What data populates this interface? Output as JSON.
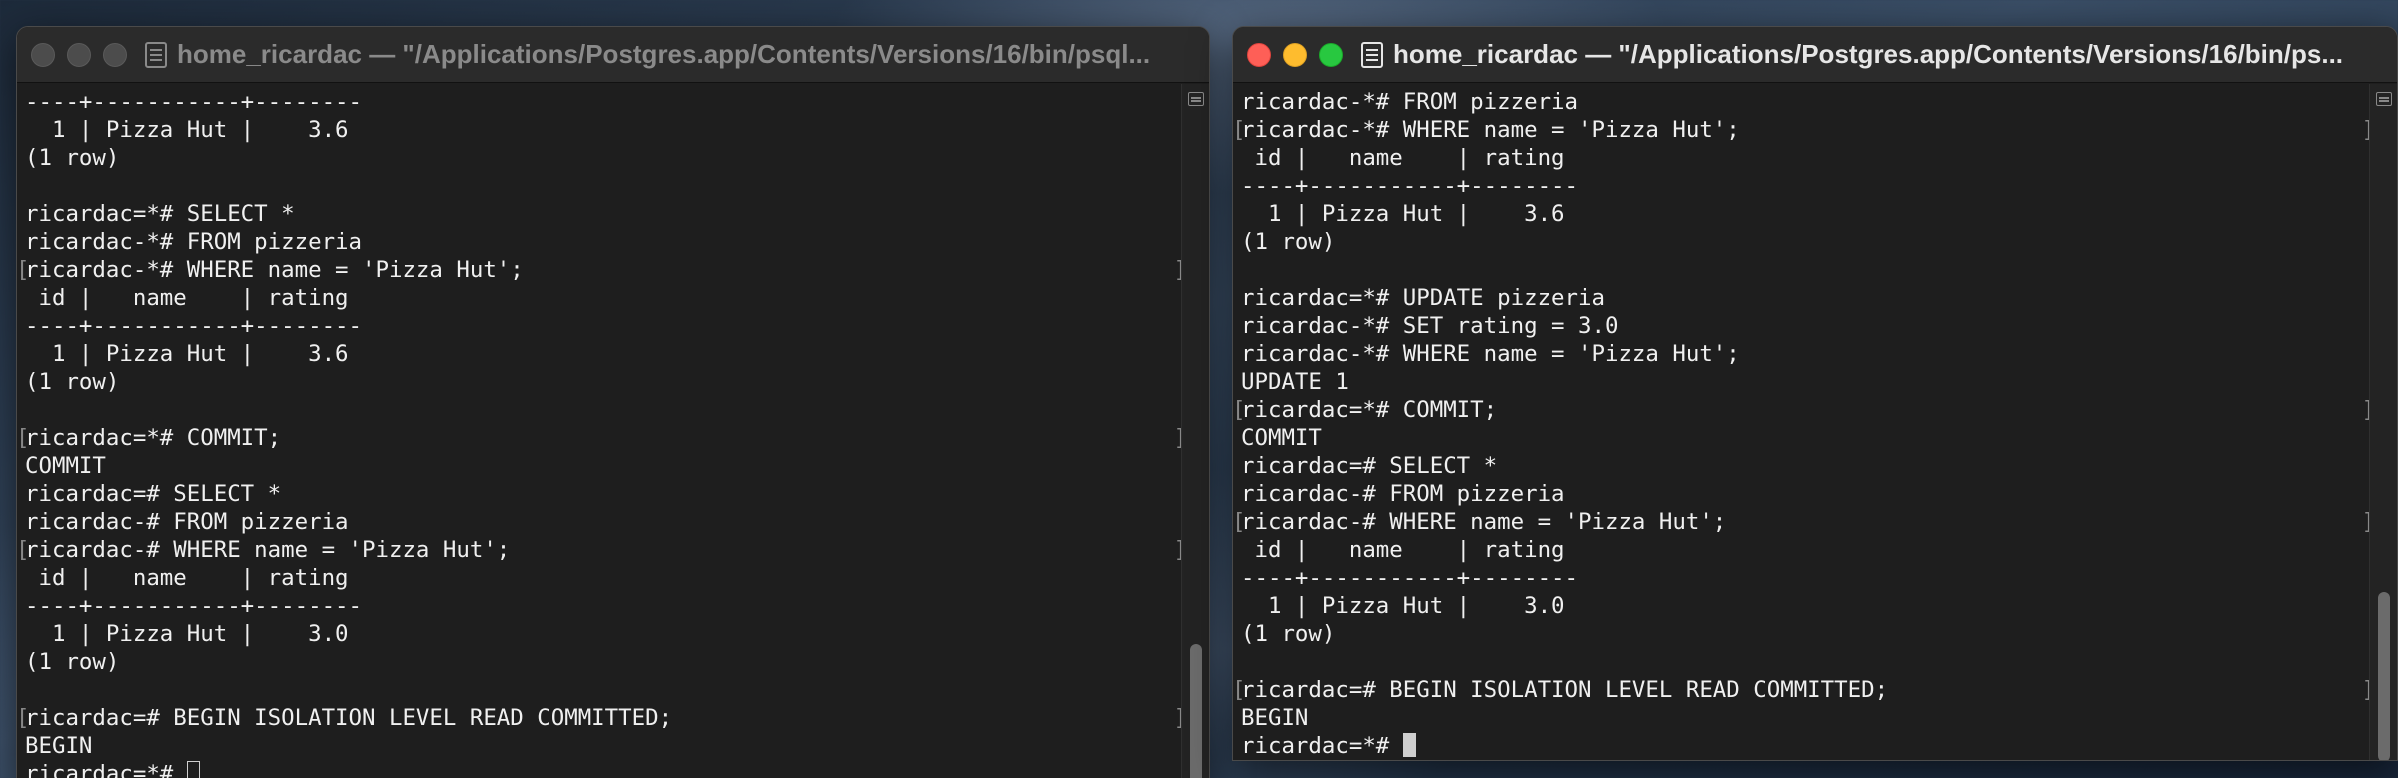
{
  "windows": {
    "left": {
      "title": "home_ricardac — \"/Applications/Postgres.app/Contents/Versions/16/bin/psql...",
      "lines": [
        {
          "text": "----+-----------+--------",
          "mark": false
        },
        {
          "text": "  1 | Pizza Hut |    3.6",
          "mark": false
        },
        {
          "text": "(1 row)",
          "mark": false
        },
        {
          "text": "",
          "mark": false
        },
        {
          "text": "ricardac=*# SELECT *",
          "mark": false
        },
        {
          "text": "ricardac-*# FROM pizzeria",
          "mark": false
        },
        {
          "text": "ricardac-*# WHERE name = 'Pizza Hut';",
          "mark": true
        },
        {
          "text": " id |   name    | rating",
          "mark": false
        },
        {
          "text": "----+-----------+--------",
          "mark": false
        },
        {
          "text": "  1 | Pizza Hut |    3.6",
          "mark": false
        },
        {
          "text": "(1 row)",
          "mark": false
        },
        {
          "text": "",
          "mark": false
        },
        {
          "text": "ricardac=*# COMMIT;",
          "mark": true
        },
        {
          "text": "COMMIT",
          "mark": false
        },
        {
          "text": "ricardac=# SELECT *",
          "mark": false
        },
        {
          "text": "ricardac-# FROM pizzeria",
          "mark": false
        },
        {
          "text": "ricardac-# WHERE name = 'Pizza Hut';",
          "mark": true
        },
        {
          "text": " id |   name    | rating",
          "mark": false
        },
        {
          "text": "----+-----------+--------",
          "mark": false
        },
        {
          "text": "  1 | Pizza Hut |    3.0",
          "mark": false
        },
        {
          "text": "(1 row)",
          "mark": false
        },
        {
          "text": "",
          "mark": false
        },
        {
          "text": "ricardac=# BEGIN ISOLATION LEVEL READ COMMITTED;",
          "mark": true
        },
        {
          "text": "BEGIN",
          "mark": false
        },
        {
          "text": "ricardac=*# ",
          "mark": false,
          "cursor": true
        }
      ]
    },
    "right": {
      "title": "home_ricardac — \"/Applications/Postgres.app/Contents/Versions/16/bin/ps...",
      "lines": [
        {
          "text": "ricardac-*# FROM pizzeria",
          "mark": false
        },
        {
          "text": "ricardac-*# WHERE name = 'Pizza Hut';",
          "mark": true
        },
        {
          "text": " id |   name    | rating",
          "mark": false
        },
        {
          "text": "----+-----------+--------",
          "mark": false
        },
        {
          "text": "  1 | Pizza Hut |    3.6",
          "mark": false
        },
        {
          "text": "(1 row)",
          "mark": false
        },
        {
          "text": "",
          "mark": false
        },
        {
          "text": "ricardac=*# UPDATE pizzeria",
          "mark": false
        },
        {
          "text": "ricardac-*# SET rating = 3.0",
          "mark": false
        },
        {
          "text": "ricardac-*# WHERE name = 'Pizza Hut';",
          "mark": false
        },
        {
          "text": "UPDATE 1",
          "mark": false
        },
        {
          "text": "ricardac=*# COMMIT;",
          "mark": true
        },
        {
          "text": "COMMIT",
          "mark": false
        },
        {
          "text": "ricardac=# SELECT *",
          "mark": false
        },
        {
          "text": "ricardac-# FROM pizzeria",
          "mark": false
        },
        {
          "text": "ricardac-# WHERE name = 'Pizza Hut';",
          "mark": true
        },
        {
          "text": " id |   name    | rating",
          "mark": false
        },
        {
          "text": "----+-----------+--------",
          "mark": false
        },
        {
          "text": "  1 | Pizza Hut |    3.0",
          "mark": false
        },
        {
          "text": "(1 row)",
          "mark": false
        },
        {
          "text": "",
          "mark": false
        },
        {
          "text": "ricardac=# BEGIN ISOLATION LEVEL READ COMMITTED;",
          "mark": true
        },
        {
          "text": "BEGIN",
          "mark": false
        },
        {
          "text": "ricardac=*# ",
          "mark": false,
          "cursor": true
        }
      ]
    }
  },
  "colors": {
    "close": "#fe5f57",
    "minimize": "#febc2e",
    "maximize": "#28c840",
    "terminal_bg": "#1e1e1e"
  },
  "icons": {
    "title": "terminal-window-icon",
    "split": "split-pane-icon"
  }
}
